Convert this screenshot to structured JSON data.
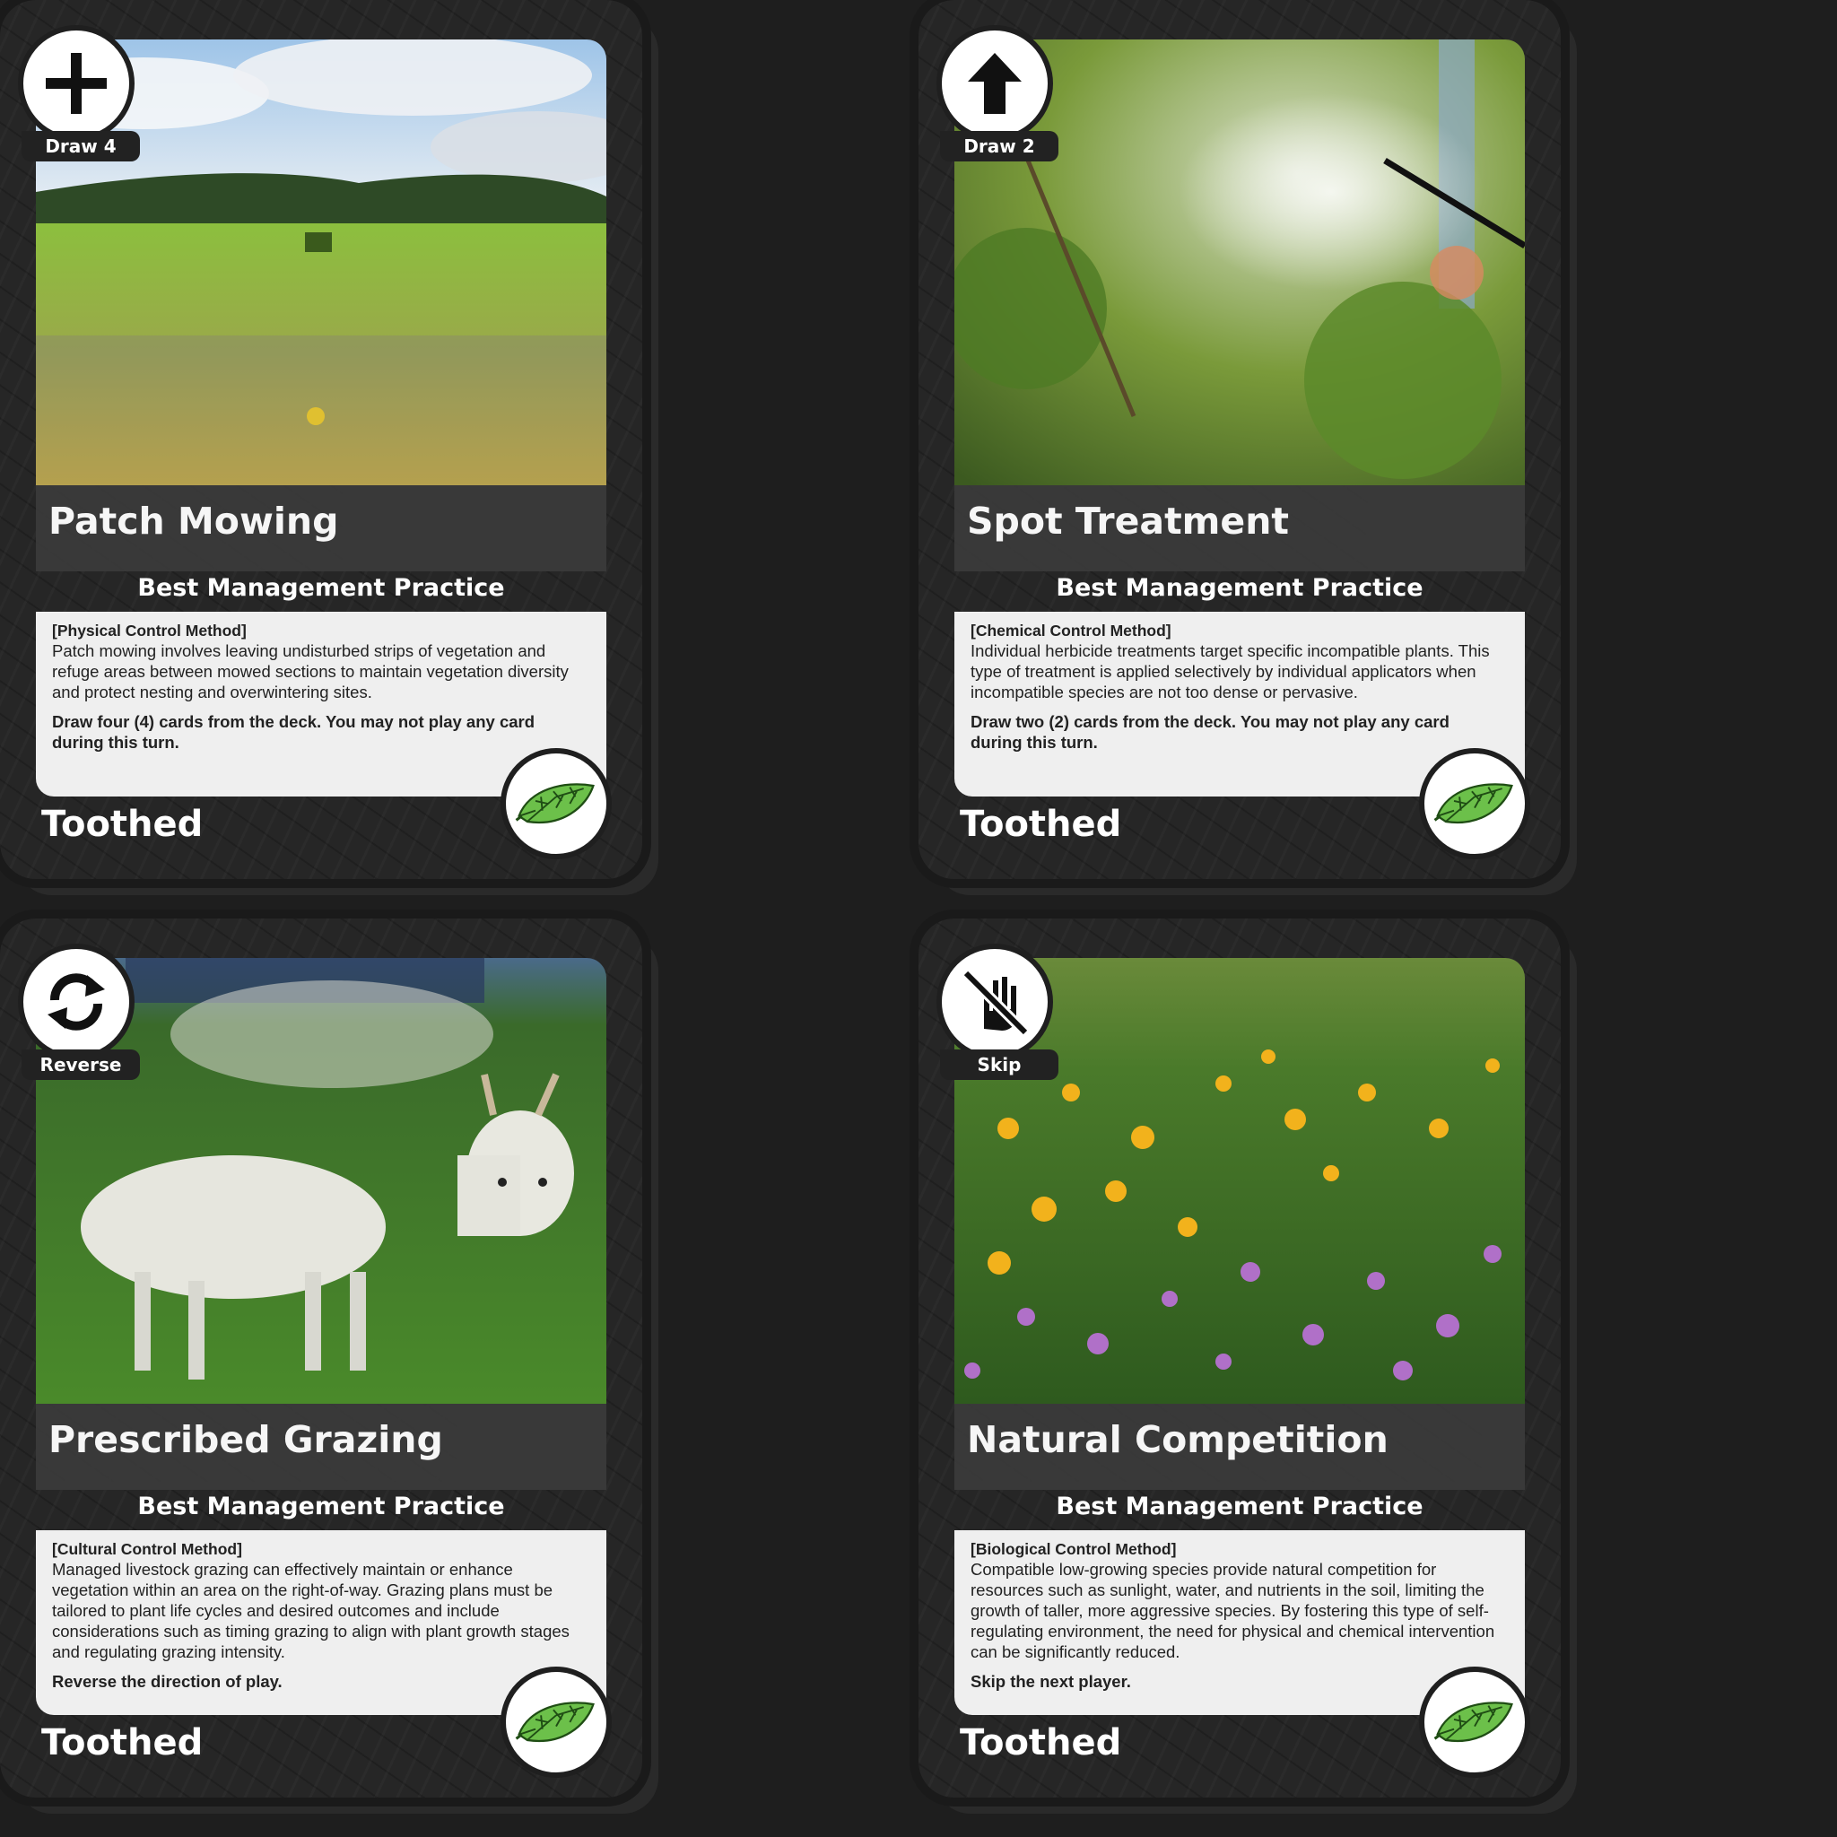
{
  "cards": [
    {
      "title": "Patch Mowing",
      "subtitle": "Best Management Practice",
      "method": "[Physical Control Method]",
      "description": "Patch mowing involves leaving undisturbed strips of vegetation and refuge areas between mowed sections to maintain vegetation diversity and protect nesting and overwintering sites.",
      "action": "Draw four (4) cards from the deck. You may not play any card during this turn.",
      "footer": "Toothed",
      "label": "Draw 4",
      "icon": "plus-icon",
      "leaf_icon": "toothed-leaf-icon",
      "photo": "meadow-with-mower-photo"
    },
    {
      "title": "Spot Treatment",
      "subtitle": "Best Management Practice",
      "method": "[Chemical Control Method]",
      "description": "Individual herbicide treatments target specific incompatible plants. This type of treatment is applied selectively by individual applicators when incompatible species are not too dense or pervasive.",
      "action": "Draw two (2) cards from the deck. You may not play any card during this turn.",
      "footer": "Toothed",
      "label": "Draw 2",
      "icon": "arrow-up-icon",
      "leaf_icon": "toothed-leaf-icon",
      "photo": "herbicide-spray-photo"
    },
    {
      "title": "Prescribed Grazing",
      "subtitle": "Best Management Practice",
      "method": "[Cultural Control Method]",
      "description": "Managed livestock grazing can effectively maintain or enhance vegetation within an area on the right-of-way. Grazing plans must be tailored to plant life cycles and desired outcomes and include considerations such as timing grazing to align with plant growth stages and regulating grazing intensity.",
      "action": "Reverse the direction of play.",
      "footer": "Toothed",
      "label": "Reverse",
      "icon": "reverse-arrows-icon",
      "leaf_icon": "toothed-leaf-icon",
      "photo": "white-goat-grazing-photo"
    },
    {
      "title": "Natural Competition",
      "subtitle": "Best Management Practice",
      "method": "[Biological Control Method]",
      "description": "Compatible low-growing species provide natural competition for resources such as sunlight, water, and nutrients in the soil, limiting the growth of taller, more aggressive species. By fostering this type of self-regulating environment, the need for physical and chemical intervention can be significantly reduced.",
      "action": "Skip the next player.",
      "footer": "Toothed",
      "label": "Skip",
      "icon": "skip-hand-icon",
      "leaf_icon": "toothed-leaf-icon",
      "photo": "wildflower-meadow-photo"
    }
  ]
}
